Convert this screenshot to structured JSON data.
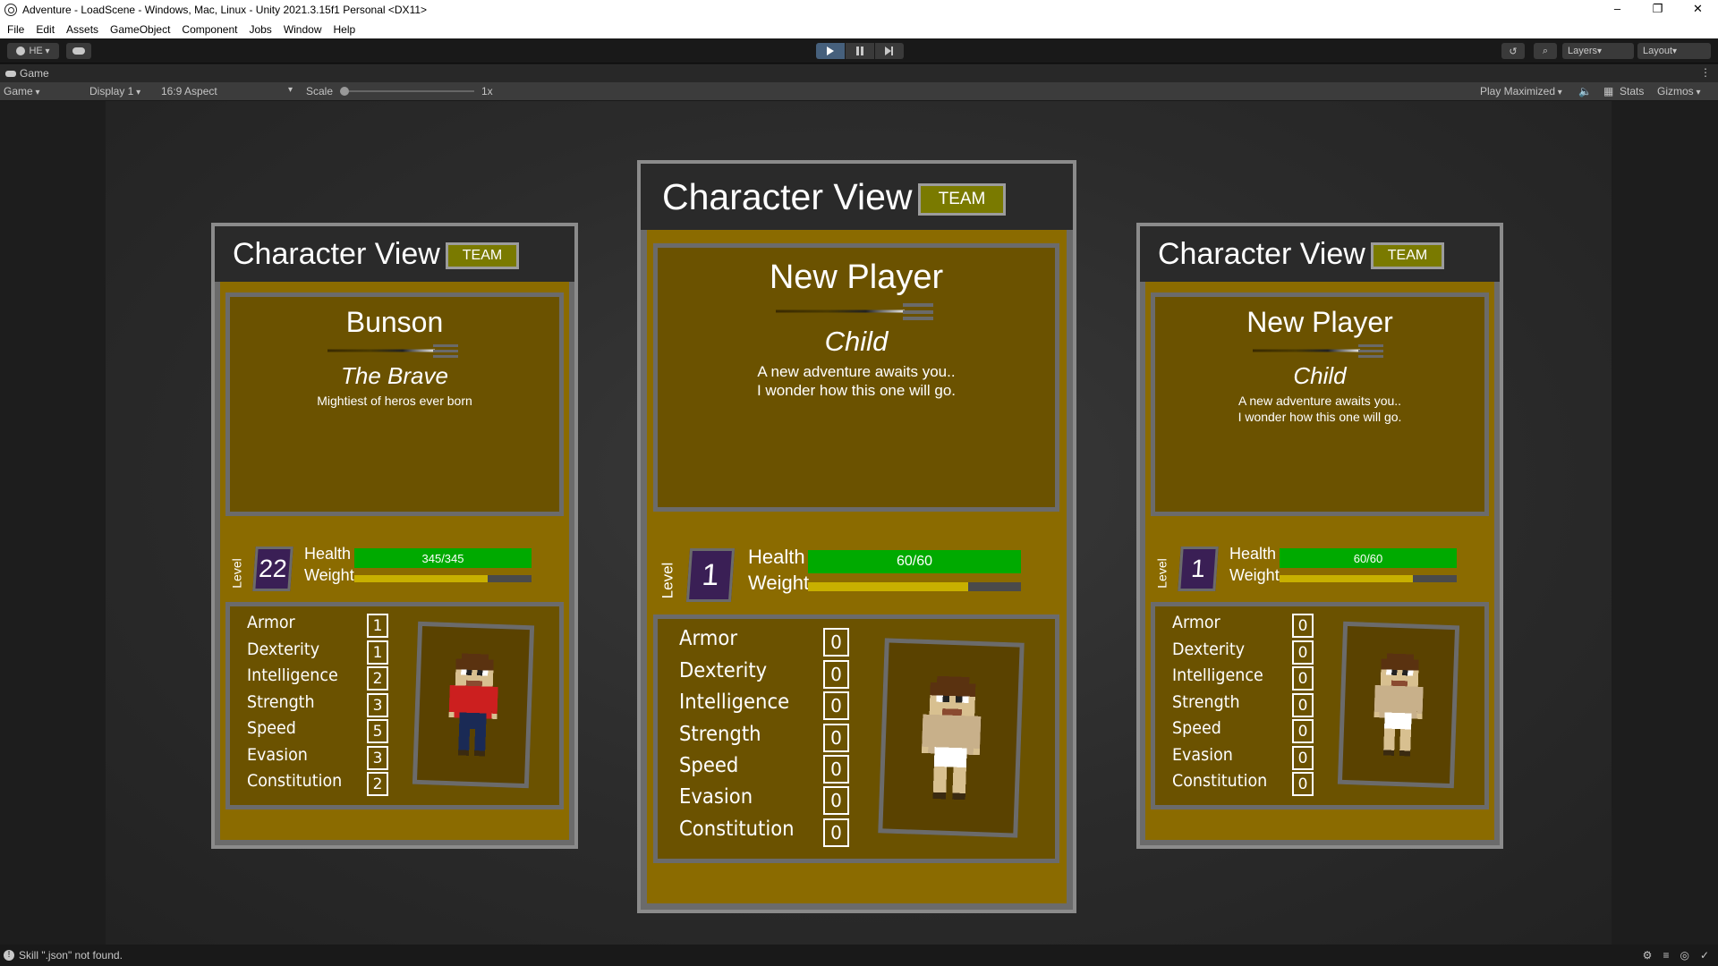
{
  "window": {
    "title": "Adventure - LoadScene - Windows, Mac, Linux - Unity 2021.3.15f1 Personal <DX11>",
    "minimize": "–",
    "restore": "❐",
    "close": "✕"
  },
  "menu": [
    "File",
    "Edit",
    "Assets",
    "GameObject",
    "Component",
    "Jobs",
    "Window",
    "Help"
  ],
  "toolbar": {
    "account": "HE",
    "layers": "Layers",
    "layout": "Layout"
  },
  "tab": {
    "label": "Game"
  },
  "gamebar": {
    "mode": "Game",
    "display": "Display 1",
    "aspect": "16:9 Aspect",
    "scale_label": "Scale",
    "scale_value": "1x",
    "play_mode": "Play Maximized",
    "stats": "Stats",
    "gizmos": "Gizmos"
  },
  "status": {
    "message": "Skill \".json\" not found."
  },
  "cards": [
    {
      "header": "Character View",
      "team": "TEAM",
      "name": "Bunson",
      "title": "The Brave",
      "description": "Mightiest of heros ever born",
      "level_word": "Level",
      "level": "22",
      "health_label": "Health",
      "health": "345/345",
      "weight_label": "Weight",
      "weight_fraction": 0.75,
      "stats": [
        {
          "name": "Armor",
          "value": "1"
        },
        {
          "name": "Dexterity",
          "value": "1"
        },
        {
          "name": "Intelligence",
          "value": "2"
        },
        {
          "name": "Strength",
          "value": "3"
        },
        {
          "name": "Speed",
          "value": "5"
        },
        {
          "name": "Evasion",
          "value": "3"
        },
        {
          "name": "Constitution",
          "value": "2"
        }
      ],
      "shirt": "#cc1f1f",
      "pants": "#1a2a55"
    },
    {
      "header": "Character View",
      "team": "TEAM",
      "name": "New Player",
      "title": "Child",
      "description": "A new adventure awaits you..\nI wonder how this one will go.",
      "level_word": "Level",
      "level": "1",
      "health_label": "Health",
      "health": "60/60",
      "weight_label": "Weight",
      "weight_fraction": 0.75,
      "stats": [
        {
          "name": "Armor",
          "value": "0"
        },
        {
          "name": "Dexterity",
          "value": "0"
        },
        {
          "name": "Intelligence",
          "value": "0"
        },
        {
          "name": "Strength",
          "value": "0"
        },
        {
          "name": "Speed",
          "value": "0"
        },
        {
          "name": "Evasion",
          "value": "0"
        },
        {
          "name": "Constitution",
          "value": "0"
        }
      ],
      "shirt": "#c8b08a",
      "pants": "#ffffff"
    },
    {
      "header": "Character View",
      "team": "TEAM",
      "name": "New Player",
      "title": "Child",
      "description": "A new adventure awaits you..\nI wonder how this one will go.",
      "level_word": "Level",
      "level": "1",
      "health_label": "Health",
      "health": "60/60",
      "weight_label": "Weight",
      "weight_fraction": 0.75,
      "stats": [
        {
          "name": "Armor",
          "value": "0"
        },
        {
          "name": "Dexterity",
          "value": "0"
        },
        {
          "name": "Intelligence",
          "value": "0"
        },
        {
          "name": "Strength",
          "value": "0"
        },
        {
          "name": "Speed",
          "value": "0"
        },
        {
          "name": "Evasion",
          "value": "0"
        },
        {
          "name": "Constitution",
          "value": "0"
        }
      ],
      "shirt": "#c8b08a",
      "pants": "#ffffff"
    }
  ]
}
